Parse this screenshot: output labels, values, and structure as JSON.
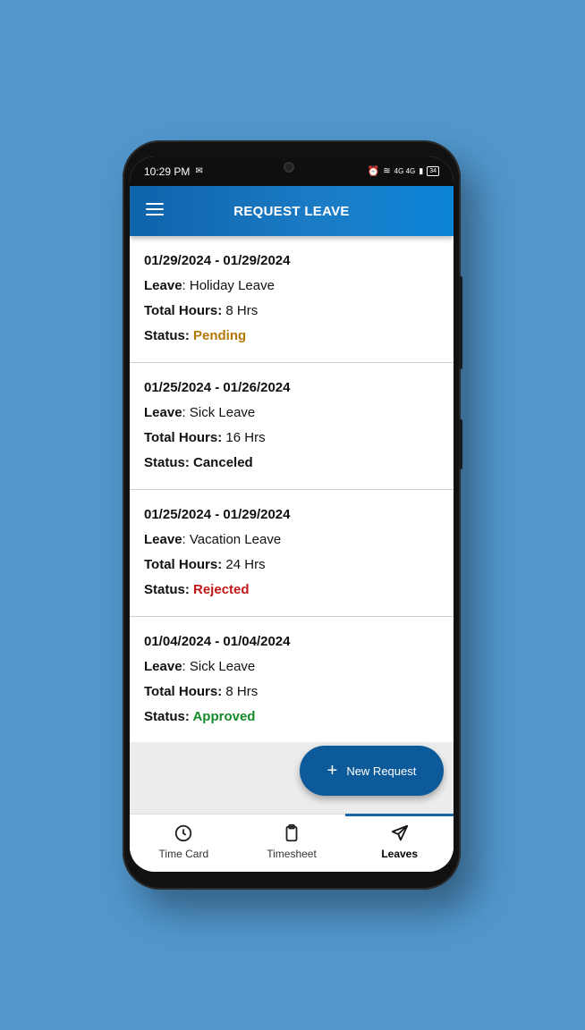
{
  "status_bar": {
    "time": "10:29 PM",
    "right_text": "4G 4G",
    "battery": "34"
  },
  "app_bar": {
    "title": "REQUEST LEAVE"
  },
  "labels": {
    "leave": "Leave",
    "total_hours": "Total Hours:",
    "status": "Status:"
  },
  "leaves": [
    {
      "dates": "01/29/2024 - 01/29/2024",
      "leave": ": Holiday Leave",
      "hours": " 8 Hrs",
      "status": " Pending",
      "status_color": "#b57806"
    },
    {
      "dates": "01/25/2024 - 01/26/2024",
      "leave": ": Sick Leave",
      "hours": " 16 Hrs",
      "status": " Canceled",
      "status_color": "#111111"
    },
    {
      "dates": "01/25/2024 - 01/29/2024",
      "leave": ": Vacation Leave",
      "hours": " 24 Hrs",
      "status": " Rejected",
      "status_color": "#c01818"
    },
    {
      "dates": "01/04/2024 - 01/04/2024",
      "leave": ": Sick Leave",
      "hours": " 8 Hrs",
      "status": " Approved",
      "status_color": "#168a28"
    }
  ],
  "fab": {
    "icon": "plus-icon",
    "label": "New Request"
  },
  "bottom_nav": {
    "items": [
      {
        "label": "Time Card",
        "icon": "clock-icon",
        "active": false
      },
      {
        "label": "Timesheet",
        "icon": "clipboard-icon",
        "active": false
      },
      {
        "label": "Leaves",
        "icon": "send-icon",
        "active": true
      }
    ]
  },
  "colors": {
    "background": "#5196cc",
    "app_bar": "#1b7cc6",
    "fab": "#0d5a9a",
    "active_tab_indicator": "#1565a8"
  }
}
